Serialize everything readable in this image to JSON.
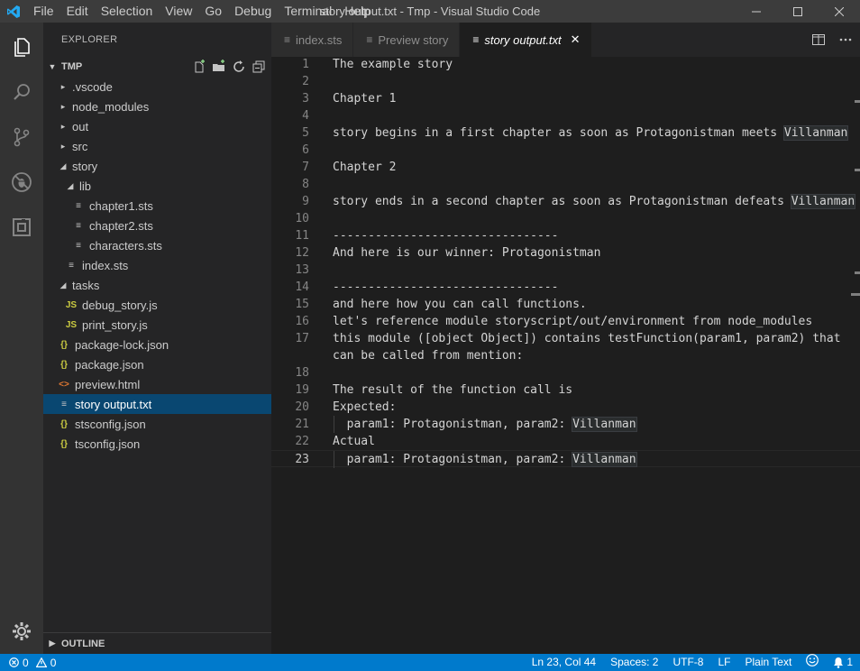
{
  "titlebar": {
    "menu": [
      "File",
      "Edit",
      "Selection",
      "View",
      "Go",
      "Debug",
      "Terminal",
      "Help"
    ],
    "window_title": "story output.txt - Tmp - Visual Studio Code"
  },
  "sidebar": {
    "title": "EXPLORER",
    "section": "TMP",
    "tree": [
      {
        "label": ".vscode",
        "kind": "folder",
        "expanded": false,
        "depth": 0
      },
      {
        "label": "node_modules",
        "kind": "folder",
        "expanded": false,
        "depth": 0
      },
      {
        "label": "out",
        "kind": "folder",
        "expanded": false,
        "depth": 0
      },
      {
        "label": "src",
        "kind": "folder",
        "expanded": false,
        "depth": 0
      },
      {
        "label": "story",
        "kind": "folder",
        "expanded": true,
        "depth": 0
      },
      {
        "label": "lib",
        "kind": "folder",
        "expanded": true,
        "depth": 1
      },
      {
        "label": "chapter1.sts",
        "kind": "text",
        "depth": 2
      },
      {
        "label": "chapter2.sts",
        "kind": "text",
        "depth": 2
      },
      {
        "label": "characters.sts",
        "kind": "text",
        "depth": 2
      },
      {
        "label": "index.sts",
        "kind": "text",
        "depth": 1
      },
      {
        "label": "tasks",
        "kind": "folder",
        "expanded": true,
        "depth": 0
      },
      {
        "label": "debug_story.js",
        "kind": "js",
        "depth": 1
      },
      {
        "label": "print_story.js",
        "kind": "js",
        "depth": 1
      },
      {
        "label": "package-lock.json",
        "kind": "json",
        "depth": 0
      },
      {
        "label": "package.json",
        "kind": "json",
        "depth": 0
      },
      {
        "label": "preview.html",
        "kind": "html",
        "depth": 0
      },
      {
        "label": "story output.txt",
        "kind": "text",
        "depth": 0,
        "selected": true
      },
      {
        "label": "stsconfig.json",
        "kind": "json",
        "depth": 0
      },
      {
        "label": "tsconfig.json",
        "kind": "json",
        "depth": 0
      }
    ],
    "outline": "OUTLINE"
  },
  "tabs": [
    {
      "label": "index.sts",
      "active": false
    },
    {
      "label": "Preview story",
      "active": false
    },
    {
      "label": "story output.txt",
      "active": true
    }
  ],
  "editor": {
    "current_line": 23,
    "lines": [
      {
        "n": "1",
        "text": "The example story"
      },
      {
        "n": "2",
        "text": ""
      },
      {
        "n": "3",
        "text": "Chapter 1"
      },
      {
        "n": "4",
        "text": ""
      },
      {
        "n": "5",
        "text": "story begins in a first chapter as soon as Protagonistman meets ",
        "hl": "Villanman"
      },
      {
        "n": "6",
        "text": ""
      },
      {
        "n": "7",
        "text": "Chapter 2"
      },
      {
        "n": "8",
        "text": ""
      },
      {
        "n": "9",
        "text": "story ends in a second chapter as soon as Protagonistman defeats ",
        "hl": "Villanman"
      },
      {
        "n": "10",
        "text": ""
      },
      {
        "n": "11",
        "text": "--------------------------------"
      },
      {
        "n": "12",
        "text": "And here is our winner: Protagonistman"
      },
      {
        "n": "13",
        "text": ""
      },
      {
        "n": "14",
        "text": "--------------------------------"
      },
      {
        "n": "15",
        "text": "and here how you can call functions."
      },
      {
        "n": "16",
        "text": "let's reference module storyscript/out/environment from node_modules"
      },
      {
        "n": "17",
        "text": "this module ([object Object]) contains testFunction(param1, param2) that"
      },
      {
        "n": "",
        "text": "can be called from mention:"
      },
      {
        "n": "18",
        "text": ""
      },
      {
        "n": "19",
        "text": "The result of the function call is"
      },
      {
        "n": "20",
        "text": "Expected:"
      },
      {
        "n": "21",
        "text": "  param1: Protagonistman, param2: ",
        "hl": "Villanman",
        "guide": true
      },
      {
        "n": "22",
        "text": "Actual"
      },
      {
        "n": "23",
        "text": "  param1: Protagonistman, param2: ",
        "hl": "Villanman",
        "guide": true
      }
    ]
  },
  "statusbar": {
    "errors": "0",
    "warnings": "0",
    "position": "Ln 23, Col 44",
    "spaces": "Spaces: 2",
    "encoding": "UTF-8",
    "eol": "LF",
    "language": "Plain Text",
    "notifications": "1"
  },
  "icons": {
    "app": "vscode-logo-icon",
    "activity": [
      "files-icon",
      "search-icon",
      "source-control-icon",
      "debug-icon",
      "extensions-icon"
    ],
    "manage": "gear-icon",
    "accent": "#007acc"
  }
}
